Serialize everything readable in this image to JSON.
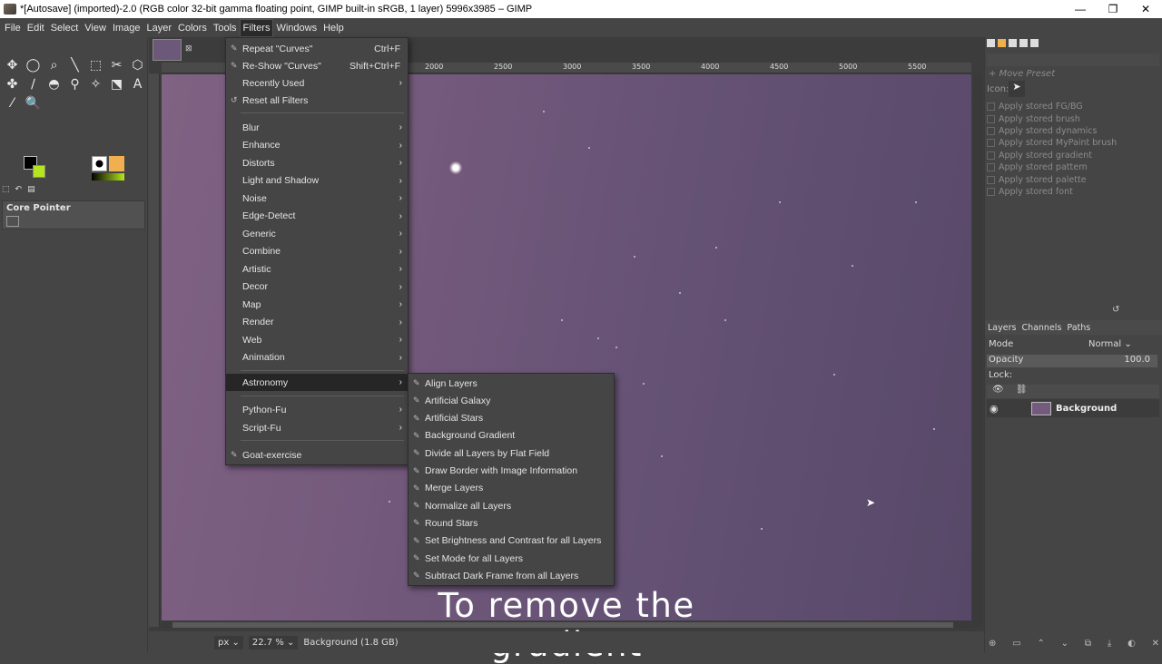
{
  "window": {
    "title": "*[Autosave] (imported)-2.0 (RGB color 32-bit gamma floating point, GIMP built-in sRGB, 1 layer) 5996x3985 – GIMP",
    "minimize": "—",
    "maximize": "❐",
    "close": "✕"
  },
  "menubar": [
    "File",
    "Edit",
    "Select",
    "View",
    "Image",
    "Layer",
    "Colors",
    "Tools",
    "Filters",
    "Windows",
    "Help"
  ],
  "toolbox": {
    "tools": [
      "✥",
      "◯",
      "⌕",
      "╲",
      "⬚",
      "✂",
      "⬡",
      "✤",
      "∕",
      "◓",
      "⚲",
      "✧",
      "⬔",
      "A",
      "⁄",
      "🔍"
    ],
    "panel_title": "Core Pointer"
  },
  "rulers": {
    "top": [
      "2000",
      "2500",
      "3000",
      "3500",
      "4000",
      "4500",
      "5000",
      "5500"
    ]
  },
  "filters_menu": {
    "items": [
      {
        "label": "Repeat \"Curves\"",
        "accel": "Ctrl+F",
        "icon": "✎"
      },
      {
        "label": "Re-Show \"Curves\"",
        "accel": "Shift+Ctrl+F",
        "icon": "✎"
      },
      {
        "label": "Recently Used",
        "accel": "",
        "icon": ""
      },
      {
        "label": "Reset all Filters",
        "accel": "",
        "icon": "↺"
      },
      {
        "label": "Blur"
      },
      {
        "label": "Enhance"
      },
      {
        "label": "Distorts"
      },
      {
        "label": "Light and Shadow"
      },
      {
        "label": "Noise"
      },
      {
        "label": "Edge-Detect"
      },
      {
        "label": "Generic"
      },
      {
        "label": "Combine"
      },
      {
        "label": "Artistic"
      },
      {
        "label": "Decor"
      },
      {
        "label": "Map"
      },
      {
        "label": "Render"
      },
      {
        "label": "Web"
      },
      {
        "label": "Animation"
      },
      {
        "label": "Astronomy"
      },
      {
        "label": "Python-Fu"
      },
      {
        "label": "Script-Fu"
      },
      {
        "label": "Goat-exercise"
      }
    ]
  },
  "astronomy_menu": {
    "items": [
      "Align Layers",
      "Artificial Galaxy",
      "Artificial Stars",
      "Background Gradient",
      "Divide all Layers by Flat Field",
      "Draw Border with Image Information",
      "Merge Layers",
      "Normalize all Layers",
      "Round Stars",
      "Set Brightness and Contrast for all Layers",
      "Set Mode for all Layers",
      "Subtract Dark Frame from all Layers"
    ]
  },
  "caption": "To remove the gradient",
  "statusbar": {
    "unit": "px ⌄",
    "zoom": "22.7 % ⌄",
    "info": "Background (1.8 GB)"
  },
  "dock": {
    "move_preset": "+ Move Preset",
    "icon_label": "Icon:",
    "apply_options": [
      "Apply stored FG/BG",
      "Apply stored brush",
      "Apply stored dynamics",
      "Apply stored MyPaint brush",
      "Apply stored gradient",
      "Apply stored pattern",
      "Apply stored palette",
      "Apply stored font"
    ],
    "layer_tabs": [
      "Layers",
      "Channels",
      "Paths"
    ],
    "mode_label": "Mode",
    "mode_value": "Normal ⌄",
    "opacity_label": "Opacity",
    "opacity_value": "100.0",
    "lock_label": "Lock:",
    "layer_name": "Background"
  },
  "colors": {
    "fg": "#000000",
    "bg": "#b5e61d",
    "image_tint": "#745a7c"
  }
}
